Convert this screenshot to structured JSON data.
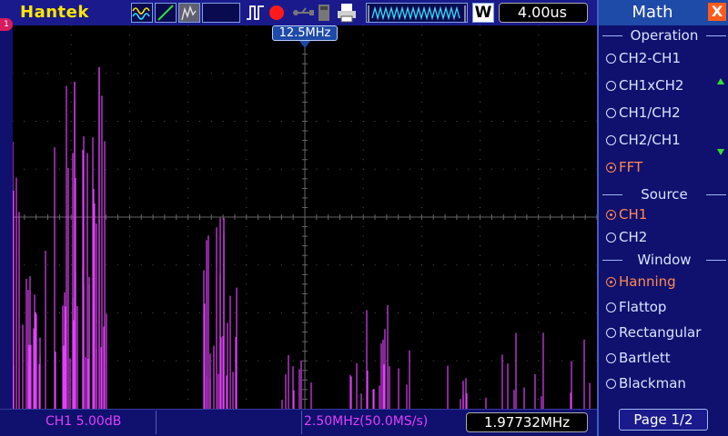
{
  "header": {
    "brand": "Hantek",
    "timebase": "4.00us",
    "window_mode": "W"
  },
  "screen": {
    "channel_marker": "1",
    "center_frequency": "12.5MHz",
    "spectrum_color": "#e040fb"
  },
  "status": {
    "ch1_scale": "CH1 5.00dB",
    "sample_info": "2.50MHz(50.0MS/s)",
    "cursor_frequency": "1.97732MHz"
  },
  "menu": {
    "title": "Math",
    "close_label": "X",
    "operation_title": "Operation",
    "operations": [
      "CH2-CH1",
      "CH1xCH2",
      "CH1/CH2",
      "CH2/CH1",
      "FFT"
    ],
    "operation_selected": "FFT",
    "source_title": "Source",
    "sources": [
      "CH1",
      "CH2"
    ],
    "source_selected": "CH1",
    "window_title": "Window",
    "windows": [
      "Hanning",
      "Flattop",
      "Rectangular",
      "Bartlett",
      "Blackman"
    ],
    "window_selected": "Hanning",
    "page_label": "Page 1/2"
  },
  "icons": {
    "waveform": "waveform-icon",
    "cursor": "cursor-icon",
    "persist": "persist-icon",
    "trigger_edge": "trigger-edge-icon",
    "run_state": "record-icon",
    "usb": "usb-icon",
    "save": "save-icon",
    "print": "print-icon"
  }
}
